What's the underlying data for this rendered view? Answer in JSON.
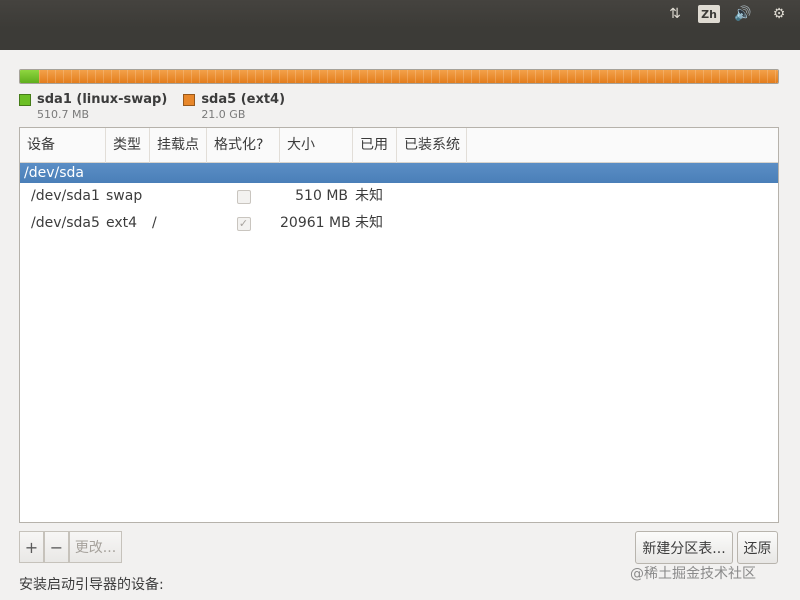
{
  "tray": {
    "network_glyph": "⇅",
    "input_method": "Zh",
    "volume_glyph": "🔊",
    "settings_glyph": "⚙"
  },
  "partitions_bar": {
    "swap_color": "#6cbf25",
    "ext4_color": "#e8872a"
  },
  "legend": [
    {
      "name": "sda1 (linux-swap)",
      "size": "510.7 MB",
      "color": "#6cbf25"
    },
    {
      "name": "sda5 (ext4)",
      "size": "21.0 GB",
      "color": "#e8872a"
    }
  ],
  "table": {
    "columns": [
      "设备",
      "类型",
      "挂载点",
      "格式化?",
      "大小",
      "已用",
      "已装系统"
    ],
    "disk_row": "/dev/sda",
    "rows": [
      {
        "device": "/dev/sda1",
        "type": "swap",
        "mount": "",
        "format_mark": "",
        "size": "510 MB",
        "used": "未知"
      },
      {
        "device": "/dev/sda5",
        "type": "ext4",
        "mount": "/",
        "format_mark": "✓",
        "size": "20961 MB",
        "used": "未知"
      }
    ]
  },
  "toolbar": {
    "add_label": "+",
    "remove_label": "−",
    "change_label": "更改..."
  },
  "buttons": {
    "new_partition_table": "新建分区表...",
    "revert": "还原"
  },
  "bootloader_label": "安装启动引导器的设备:",
  "watermark": "@稀土掘金技术社区"
}
